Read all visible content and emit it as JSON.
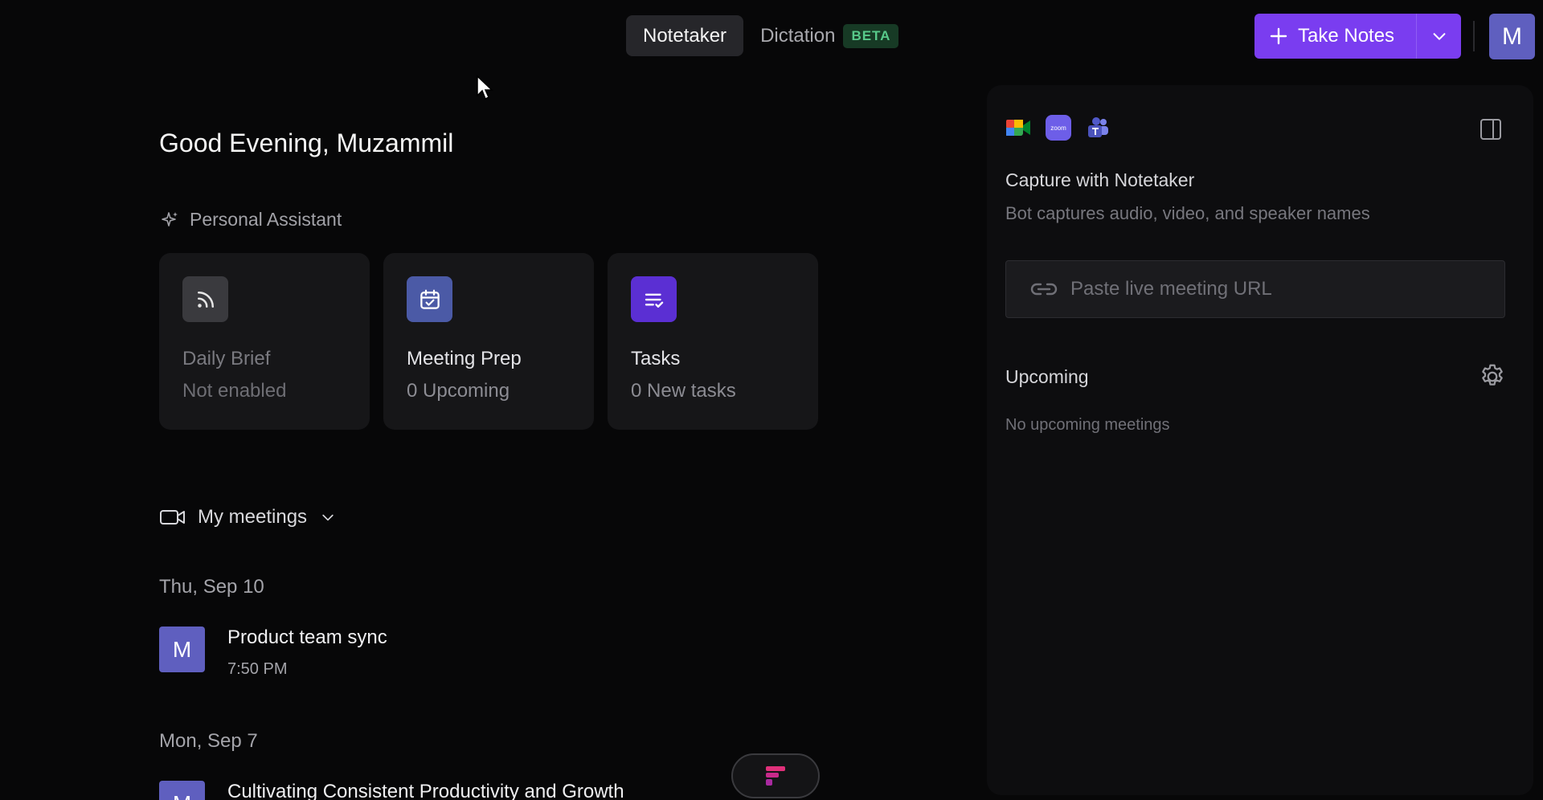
{
  "nav": {
    "tabs": [
      {
        "label": "Notetaker",
        "active": true
      },
      {
        "label": "Dictation",
        "active": false
      }
    ],
    "dictation_badge": "BETA"
  },
  "actions": {
    "take_notes_label": "Take Notes",
    "user_initial": "M"
  },
  "main": {
    "greeting": "Good Evening, Muzammil",
    "assistant_label": "Personal Assistant",
    "cards": [
      {
        "title": "Daily Brief",
        "subtitle": "Not enabled",
        "icon": "rss-icon",
        "enabled": false
      },
      {
        "title": "Meeting Prep",
        "subtitle": "0 Upcoming",
        "icon": "calendar-check-icon",
        "enabled": true
      },
      {
        "title": "Tasks",
        "subtitle": "0 New tasks",
        "icon": "task-list-icon",
        "enabled": true
      }
    ],
    "meetings_label": "My meetings",
    "meeting_groups": [
      {
        "date": "Thu, Sep 10",
        "meetings": [
          {
            "initial": "M",
            "title": "Product team sync",
            "time": "7:50 PM"
          }
        ]
      },
      {
        "date": "Mon, Sep 7",
        "meetings": [
          {
            "initial": "M",
            "title": "Cultivating Consistent Productivity and Growth",
            "time": ""
          }
        ]
      }
    ]
  },
  "panel": {
    "apps": [
      "google-meet-icon",
      "zoom-icon",
      "teams-icon"
    ],
    "capture_title": "Capture with Notetaker",
    "capture_subtitle": "Bot captures audio, video, and speaker names",
    "url_placeholder": "Paste live meeting URL",
    "upcoming_title": "Upcoming",
    "no_upcoming": "No upcoming meetings"
  },
  "colors": {
    "accent": "#7a3df0",
    "avatar": "#5f5fbf",
    "background": "#070708",
    "card": "#161618"
  }
}
